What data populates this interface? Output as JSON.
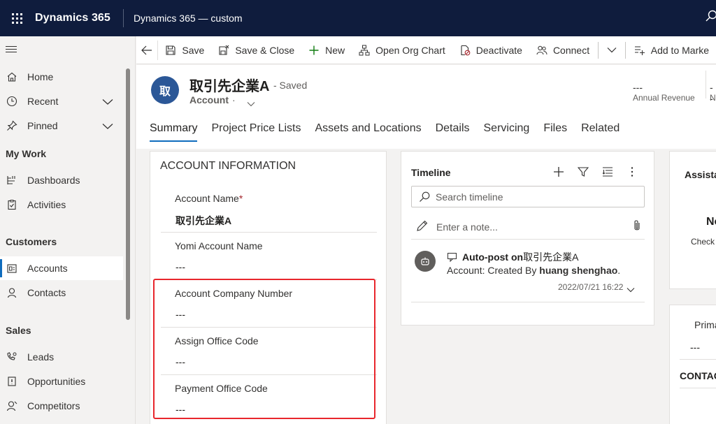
{
  "topbar": {
    "app_name": "Dynamics 365",
    "app_sub": "Dynamics 365 — custom"
  },
  "sidebar": {
    "items": [
      {
        "label": "Home",
        "icon": "home-icon"
      },
      {
        "label": "Recent",
        "icon": "clock-icon"
      },
      {
        "label": "Pinned",
        "icon": "pin-icon"
      }
    ],
    "groups": [
      {
        "title": "My Work",
        "items": [
          {
            "label": "Dashboards"
          },
          {
            "label": "Activities"
          }
        ]
      },
      {
        "title": "Customers",
        "items": [
          {
            "label": "Accounts"
          },
          {
            "label": "Contacts"
          }
        ]
      },
      {
        "title": "Sales",
        "items": [
          {
            "label": "Leads"
          },
          {
            "label": "Opportunities"
          },
          {
            "label": "Competitors"
          }
        ]
      }
    ]
  },
  "commandbar": {
    "save": "Save",
    "save_close": "Save & Close",
    "new": "New",
    "org_chart": "Open Org Chart",
    "deactivate": "Deactivate",
    "connect": "Connect",
    "add_marketing": "Add to Marke"
  },
  "record": {
    "avatar": "取",
    "title": "取引先企業A",
    "saved": "- Saved",
    "entity": "Account",
    "entity_dot": "·",
    "kpi1_value": "---",
    "kpi1_label": "Annual Revenue",
    "kpi2_value": "--",
    "kpi2_label": "N"
  },
  "tabs": [
    "Summary",
    "Project Price Lists",
    "Assets and Locations",
    "Details",
    "Servicing",
    "Files",
    "Related"
  ],
  "account_info": {
    "title": "ACCOUNT INFORMATION",
    "fields": [
      {
        "label": "Account Name",
        "required": "*",
        "value": "取引先企業A"
      },
      {
        "label": "Yomi Account Name",
        "value": "---"
      },
      {
        "label": "Account Company Number",
        "value": "---"
      },
      {
        "label": "Assign Office Code",
        "value": "---"
      },
      {
        "label": "Payment Office Code",
        "value": "---"
      }
    ]
  },
  "timeline": {
    "title": "Timeline",
    "search_placeholder": "Search timeline",
    "note_placeholder": "Enter a note...",
    "item": {
      "title_bold": "Auto-post on",
      "title_rest": " 取引先企業A",
      "line2_prefix": "Account: Created By ",
      "line2_user": "huang shenghao",
      "line2_suffix": ".",
      "timestamp": "2022/07/21 16:22"
    }
  },
  "assistant": {
    "title": "Assistan",
    "n": "No",
    "check": "Check y"
  },
  "contact": {
    "primary": "Prima",
    "value": "---",
    "title": "CONTAC"
  },
  "colors": {
    "topbar": "#0f1c3d",
    "accent": "#0f6cbd",
    "highlight": "#e8262c",
    "avatar": "#2b5797"
  }
}
